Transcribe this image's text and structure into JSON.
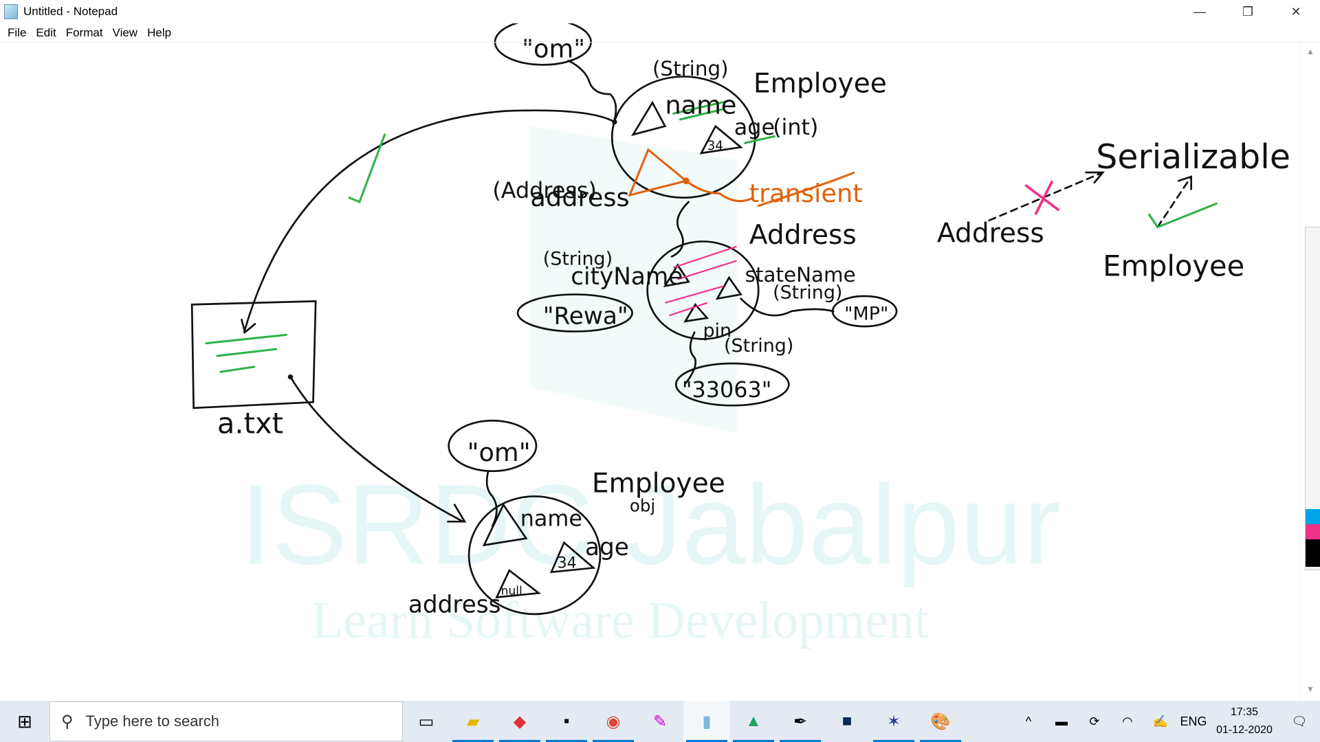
{
  "window": {
    "title": "Untitled - Notepad",
    "minimize": "—",
    "restore": "❐",
    "close": "✕"
  },
  "menu": [
    "File",
    "Edit",
    "Format",
    "View",
    "Help"
  ],
  "watermark": {
    "line1": "ISRDC Jabalpur",
    "line2": "Learn Software Development"
  },
  "drawing": {
    "top_object": {
      "name_value": "\"om\"",
      "name_type": "(String)",
      "name_field": "name",
      "class": "Employee",
      "age_field": "age",
      "age_type": "(int)",
      "age_value": "34",
      "address_type": "(Address)",
      "address_field": "address",
      "modifier": "transient"
    },
    "address_object": {
      "class": "Address",
      "city_type": "(String)",
      "city_field": "cityName",
      "city_value": "\"Rewa\"",
      "state_field": "stateName",
      "state_type": "(String)",
      "state_value": "\"MP\"",
      "pin_field": "pin",
      "pin_type": "(String)",
      "pin_value": "\"33063\""
    },
    "file": {
      "label": "a.txt"
    },
    "bottom_object": {
      "name_value": "\"om\"",
      "class": "Employee",
      "sub": "obj",
      "name_field": "name",
      "age_field": "age",
      "age_value": "34",
      "address_field": "address",
      "address_value": "null"
    },
    "interfaces": {
      "interface": "Serializable",
      "not_impl": "Address",
      "impl": "Employee"
    },
    "colors": {
      "ink": "#111111",
      "green": "#2db34a",
      "orange": "#e0620d",
      "pink": "#f0318a",
      "watermark": "#e6f6f6"
    }
  },
  "taskbar": {
    "search_placeholder": "Type here to search",
    "language": "ENG",
    "time": "17:35",
    "date": "01-12-2020"
  }
}
